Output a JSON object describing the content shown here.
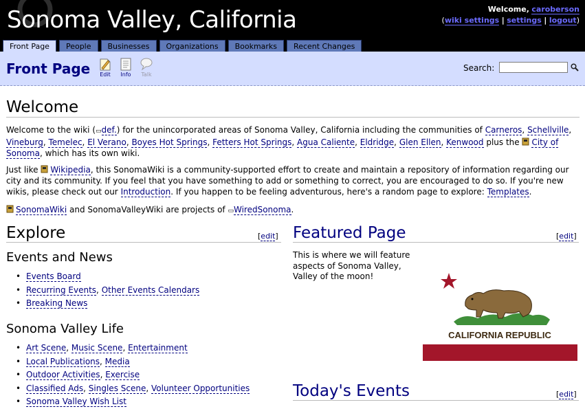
{
  "header": {
    "site_title": "Sonoma Valley, California",
    "welcome_prefix": "Welcome,",
    "username": "caroberson",
    "links": [
      "wiki settings",
      "settings",
      "logout"
    ],
    "bar": "|"
  },
  "tabs": [
    {
      "label": "Front Page",
      "active": true
    },
    {
      "label": "People"
    },
    {
      "label": "Businesses"
    },
    {
      "label": "Organizations"
    },
    {
      "label": "Bookmarks"
    },
    {
      "label": "Recent Changes"
    }
  ],
  "titlebar": {
    "page_title": "Front Page",
    "tools": [
      "Edit",
      "Info",
      "Talk"
    ],
    "search_label": "Search:",
    "search_value": ""
  },
  "welcome": {
    "heading": "Welcome",
    "p1": {
      "t1": "Welcome to the wiki (",
      "def": "def.",
      "t2": ") for the unincorporated areas of Sonoma Valley, California including the communities of ",
      "places": [
        "Carneros",
        "Schellville",
        "Vineburg",
        "Temelec",
        "El Verano",
        "Boyes Hot Springs",
        "Fetters Hot Springs",
        "Agua Caliente",
        "Eldridge",
        "Glen Ellen",
        "Kenwood"
      ],
      "t3": " plus the ",
      "city": "City of Sonoma",
      "t4": ", which has its own wiki."
    },
    "p2": {
      "t1": "Just like ",
      "wikipedia": "Wikipedia",
      "t2": ", this SonomaWiki is a community-supported effort to create and maintain a repository of information regarding our city and its community. If you feel that you have something to add or something to correct, you are encouraged to do so. If you're new wikis, please check out our ",
      "intro": "Introduction",
      "t3": ". If you happen to be feeling adventurous, here's a random page to explore: ",
      "templates": "Templates",
      "t4": "."
    },
    "p3": {
      "sonomawiki": "SonomaWiki",
      "t1": " and SonomaValleyWiki are projects of ",
      "wiredsonoma": "WiredSonoma",
      "t2": "."
    }
  },
  "explore": {
    "heading": "Explore",
    "edit": "edit",
    "events_heading": "Events and News",
    "events": [
      [
        "Events Board"
      ],
      [
        "Recurring Events",
        "Other Events Calendars"
      ],
      [
        "Breaking News"
      ]
    ],
    "life_heading": "Sonoma Valley Life",
    "life": [
      [
        "Art Scene",
        "Music Scene",
        "Entertainment"
      ],
      [
        "Local Publications",
        "Media"
      ],
      [
        "Outdoor Activities",
        "Exercise"
      ],
      [
        "Classified Ads",
        "Singles Scene",
        "Volunteer Opportunities"
      ],
      [
        "Sonoma Valley Wish List"
      ]
    ]
  },
  "featured": {
    "heading": "Featured Page",
    "edit": "edit",
    "text": "This is where we will feature aspects of Sonoma Valley, Valley of the moon!",
    "flag_text": "CALIFORNIA REPUBLIC"
  },
  "todays_events": {
    "heading": "Today's Events",
    "edit": "edit"
  },
  "colors": {
    "header_bg": "#000000",
    "tab_bg": "#5f79b8",
    "active_tab_bg": "#d4ddff",
    "link": "#00007f",
    "flag_red": "#a3162a"
  }
}
